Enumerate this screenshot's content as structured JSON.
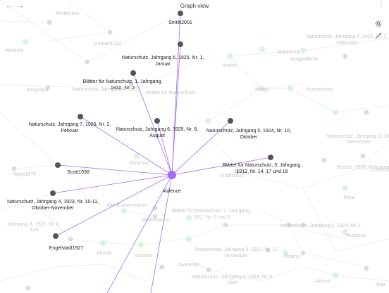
{
  "header": {
    "title": "Graph view",
    "back_icon": "arrow-left-icon",
    "forward_icon": "arrow-right-icon",
    "more_icon": "more-vertical-icon"
  },
  "sidebar_controls": {
    "settings_icon": "gear-icon",
    "magic_icon": "wand-icon"
  },
  "colors": {
    "center_node": "#a36cf2",
    "connected_node": "#555555",
    "edge": "#a36cf2",
    "tag_node": "#d7f5dc",
    "faded_node": "#dcdcdc",
    "faded_edge": "#eeeeee"
  },
  "center": {
    "label": "#silence"
  },
  "connected": [
    {
      "label": [
        "Smith2001"
      ]
    },
    {
      "label": [
        "Naturschutz, Jahrgang 6, 1925, Nr. 1,",
        "Januar"
      ]
    },
    {
      "label": [
        "Blätter für Naturschutz, 1. Jahrgang,",
        "1910, Nr. 2"
      ]
    },
    {
      "label": [
        "Naturschutz, Jahrgang 7, 1926, Nr. 2,",
        "Februar"
      ]
    },
    {
      "label": [
        "Naturschutz, Jahrgang 6, 1925, Nr. 8,",
        "August"
      ]
    },
    {
      "label": [
        "Naturschutz, Jahrgang 5, 1924, Nr. 10,",
        "Oktober"
      ]
    },
    {
      "label": [
        "Blätter für Naturschutz, 3. Jahrgang,",
        "1912, Nr. 14, 17 und 18"
      ]
    },
    {
      "label": [
        "Scott1938"
      ]
    },
    {
      "label": [
        "Naturschutz, Jahrgang 4, 1923, Nr. 10-11,",
        "Oktober-November"
      ]
    },
    {
      "label": [
        "Engelstadt1927"
      ]
    }
  ],
  "background_labels": [
    "#extinction",
    "Knauer1912",
    "Naturschutz, Jahrgang 6, 1925, Nr. 2,",
    "February",
    "#insects",
    "#birdsong",
    "#cagedBirds",
    "#voice",
    "#migration",
    "Naturschutz, Jahrgang 4, 1923",
    "Blätter für Naturschutz",
    "#frogs",
    "#cemeteries",
    "Naturschutz, Jahrgang 3, 192",
    "Dezember",
    "#tourism",
    "Nigra1874",
    "Krafft1922",
    "Bruzzo_1926_Relasione",
    "Custer18",
    "#sea",
    "#birdConservation",
    "#disturbance",
    "Blätter für Naturschutz, 2. Jahrgang,",
    "1911, Nr. 5 und 6",
    "Naturschutz, Jahrgang 5, 1924, Nr. 1",
    "Jahrgang 3, 1922, Nr. 6,",
    "Juni",
    "#science",
    "#noise",
    "#motors",
    "#waterfall",
    "Naturschutz, Jahrgang 3, 1922, Nr. 11",
    "November",
    "#hiking",
    "Naturschutz, Jahrgang 4, 1923, Nr. 6,",
    "Juni",
    "#visual",
    "#par"
  ]
}
